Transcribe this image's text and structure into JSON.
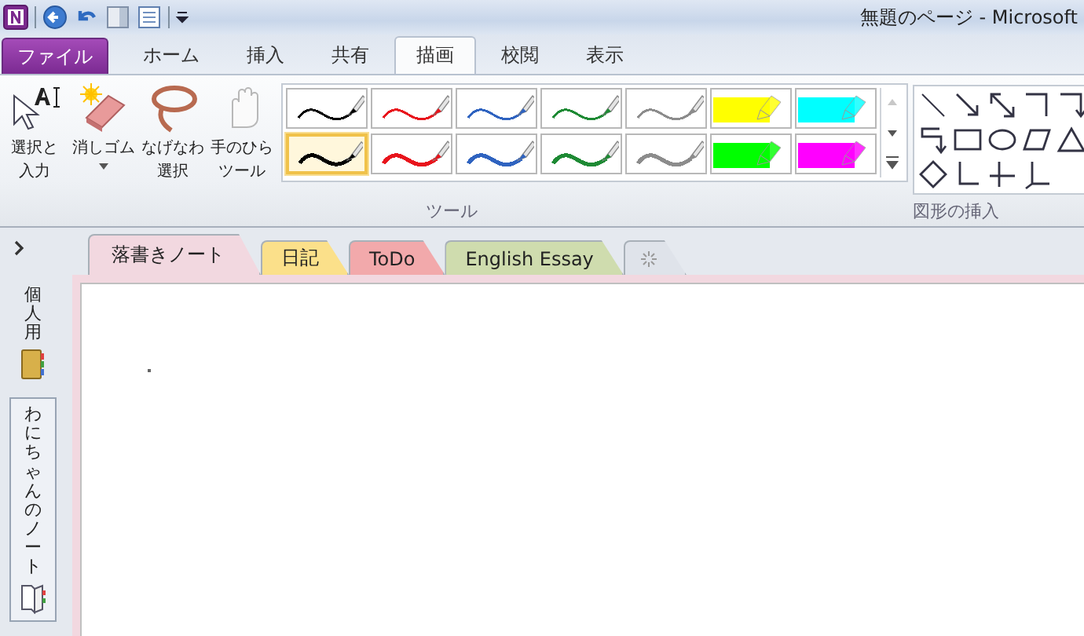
{
  "title_bar": {
    "title": "無題のページ - Microsoft"
  },
  "ribbon_tabs": [
    {
      "label": "ファイル",
      "kind": "file",
      "selected": false
    },
    {
      "label": "ホーム",
      "kind": "tab",
      "selected": false
    },
    {
      "label": "挿入",
      "kind": "tab",
      "selected": false
    },
    {
      "label": "共有",
      "kind": "tab",
      "selected": false
    },
    {
      "label": "描画",
      "kind": "tab",
      "selected": true
    },
    {
      "label": "校閲",
      "kind": "tab",
      "selected": false
    },
    {
      "label": "表示",
      "kind": "tab",
      "selected": false
    }
  ],
  "tools": [
    {
      "kind": "select",
      "lines": [
        "選択と",
        "入力"
      ],
      "dropdown": false
    },
    {
      "kind": "eraser",
      "lines": [
        "消しゴム"
      ],
      "dropdown": true
    },
    {
      "kind": "lasso",
      "lines": [
        "なげなわ",
        "選択"
      ],
      "dropdown": false
    },
    {
      "kind": "hand",
      "lines": [
        "手のひら",
        "ツール"
      ],
      "dropdown": false
    }
  ],
  "pens": [
    [
      {
        "kind": "pen-thin",
        "color": "#000000",
        "selected": false
      },
      {
        "kind": "pen-thin",
        "color": "#e8141c",
        "selected": false
      },
      {
        "kind": "pen-thin",
        "color": "#2f63c0",
        "selected": false
      },
      {
        "kind": "pen-thin",
        "color": "#1e8a34",
        "selected": false
      },
      {
        "kind": "pen-thin",
        "color": "#8c8c8c",
        "selected": false
      },
      {
        "kind": "highlighter",
        "color": "#ffff00",
        "selected": false
      },
      {
        "kind": "highlighter",
        "color": "#00ffff",
        "selected": false
      }
    ],
    [
      {
        "kind": "pen-thick",
        "color": "#000000",
        "selected": true
      },
      {
        "kind": "pen-thick",
        "color": "#e8141c",
        "selected": false
      },
      {
        "kind": "pen-thick",
        "color": "#2f63c0",
        "selected": false
      },
      {
        "kind": "pen-thick",
        "color": "#1e8a34",
        "selected": false
      },
      {
        "kind": "pen-thick",
        "color": "#8c8c8c",
        "selected": false
      },
      {
        "kind": "highlighter",
        "color": "#00ff00",
        "selected": false
      },
      {
        "kind": "highlighter",
        "color": "#ff00ff",
        "selected": false
      }
    ]
  ],
  "tools_group": {
    "label": "ツール"
  },
  "shapes_group": {
    "label": "図形の挿入"
  },
  "sidebar": {
    "notebooks": [
      {
        "name": "個人用",
        "kind": "notebook",
        "selected": false
      },
      {
        "name": "わにちゃんのノート",
        "kind": "open-book",
        "selected": true
      }
    ]
  },
  "section_tabs": [
    {
      "label": "落書きノート",
      "color": "#f2d8e0",
      "selected": true
    },
    {
      "label": "日記",
      "color": "#fbe08a",
      "selected": false
    },
    {
      "label": "ToDo",
      "color": "#f2a9ab",
      "selected": false
    },
    {
      "label": "English Essay",
      "color": "#cfdcae",
      "selected": false
    }
  ]
}
